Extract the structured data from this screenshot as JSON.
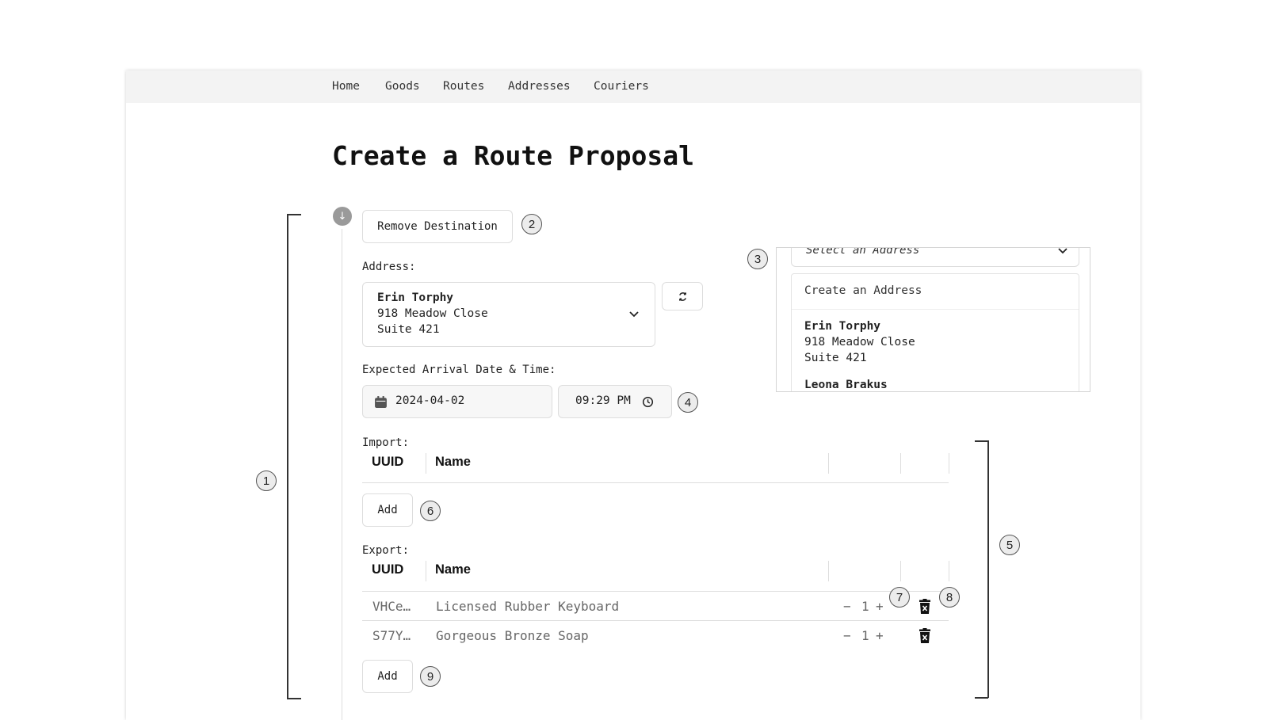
{
  "nav": {
    "items": [
      {
        "label": "Home"
      },
      {
        "label": "Goods"
      },
      {
        "label": "Routes"
      },
      {
        "label": "Addresses"
      },
      {
        "label": "Couriers"
      }
    ]
  },
  "page": {
    "title": "Create a Route Proposal"
  },
  "destination": {
    "remove_label": "Remove Destination",
    "address_label": "Address:",
    "address": {
      "name": "Erin Torphy",
      "line1": "918 Meadow Close",
      "line2": "Suite 421"
    },
    "arrival_label": "Expected Arrival Date & Time:",
    "date_value": "2024-04-02",
    "time_value": "09:29 PM"
  },
  "dropdown": {
    "placeholder": "Select an Address",
    "create_label": "Create an Address",
    "options": [
      {
        "name": "Erin Torphy",
        "line1": "918 Meadow Close",
        "line2": "Suite 421"
      },
      {
        "name": "Leona Brakus"
      }
    ]
  },
  "import": {
    "label": "Import:",
    "headers": {
      "uuid": "UUID",
      "name": "Name"
    },
    "add_label": "Add"
  },
  "export": {
    "label": "Export:",
    "headers": {
      "uuid": "UUID",
      "name": "Name"
    },
    "rows": [
      {
        "uuid": "VHCe…",
        "name": "Licensed Rubber Keyboard",
        "qty": "1"
      },
      {
        "uuid": "S77Y…",
        "name": "Gorgeous Bronze Soap",
        "qty": "1"
      }
    ],
    "add_label": "Add"
  },
  "stepper": {
    "minus": "−",
    "plus": "+"
  },
  "callouts": [
    "1",
    "2",
    "3",
    "4",
    "5",
    "6",
    "7",
    "8",
    "9"
  ],
  "icons": {
    "swap": "swap-icon",
    "calendar": "calendar-icon",
    "clock": "clock-icon",
    "chevron": "chevron-down-icon",
    "trash": "trash-icon",
    "drag": "drag-handle-icon"
  }
}
